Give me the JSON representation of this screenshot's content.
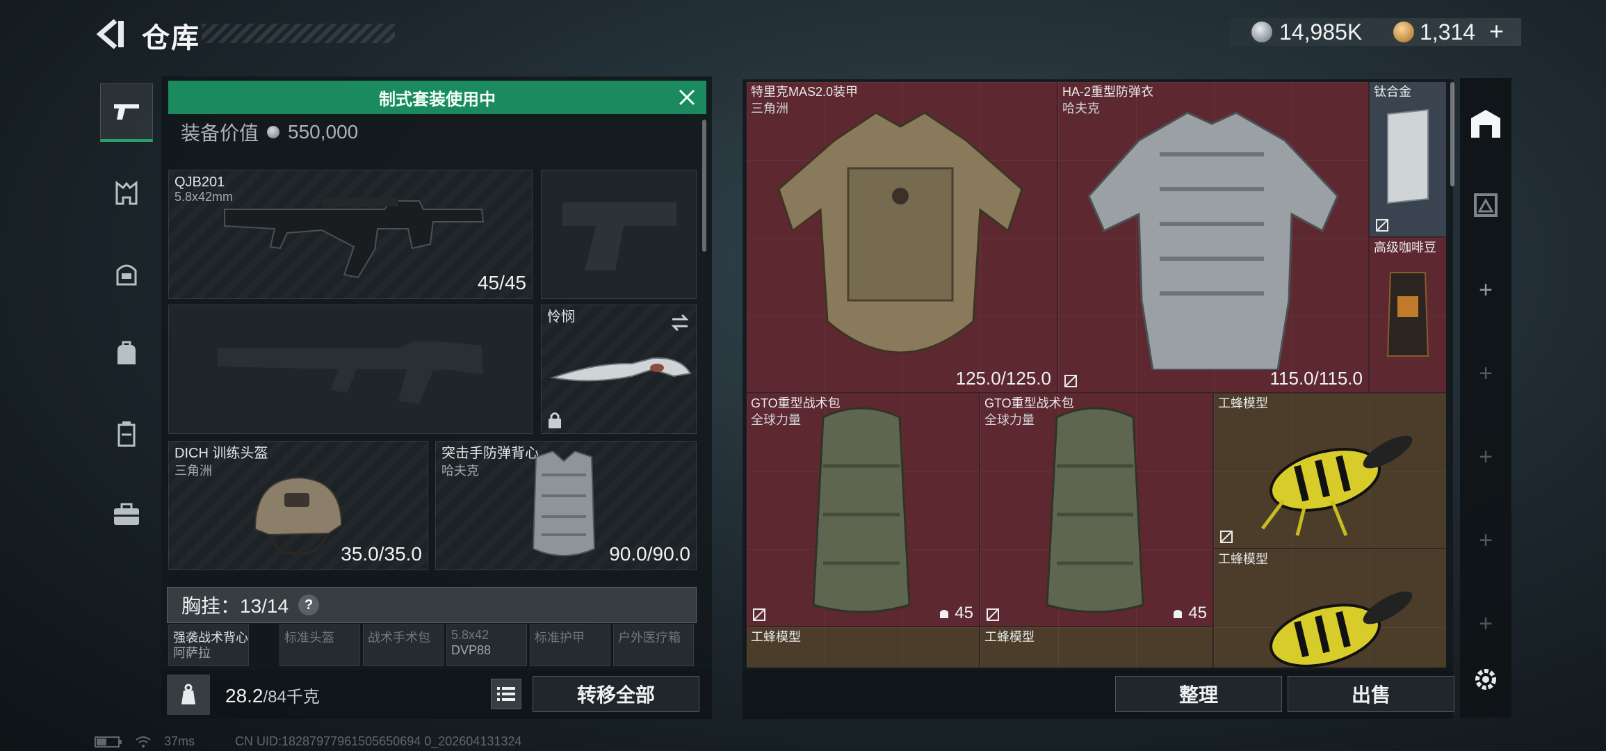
{
  "header": {
    "title": "仓库",
    "currency_1": "14,985K",
    "currency_2": "1,314",
    "currency_2_plus": "+"
  },
  "left_nav": {
    "tabs": [
      "gun-icon",
      "armor-set-icon",
      "helmet-icon",
      "backpack-icon",
      "rig-icon",
      "medkit-icon"
    ],
    "active": 0
  },
  "loadout": {
    "banner": "制式套装使用中",
    "value_label": "装备价值",
    "value": "550,000",
    "primary": {
      "name": "QJB201",
      "caliber": "5.8x42mm",
      "ammo": "45/45"
    },
    "knife": {
      "name": "怜悯"
    },
    "helmet": {
      "name": "DICH 训练头盔",
      "brand": "三角洲",
      "durability": "35.0/35.0"
    },
    "armor": {
      "name": "突击手防弹背心",
      "brand": "哈夫克",
      "durability": "90.0/90.0"
    },
    "chest_rig_label": "胸挂：13/14",
    "help": "?",
    "rig_slots": [
      {
        "name": "强袭战术背心",
        "sub": "阿萨拉",
        "filled": true
      },
      {
        "name": "标准头盔",
        "sub": "",
        "filled": false
      },
      {
        "name": "战术手术包",
        "sub": "",
        "filled": false
      },
      {
        "name": "5.8x42",
        "sub": "DVP88",
        "filled": false
      },
      {
        "name": "标准护甲",
        "sub": "",
        "filled": false
      },
      {
        "name": "户外医疗箱",
        "sub": "",
        "filled": false
      }
    ],
    "weight": "28.2",
    "weight_cap": "/84千克",
    "transfer_all": "转移全部"
  },
  "storage": {
    "items": [
      {
        "name": "特里克MAS2.0装甲",
        "brand": "三角洲",
        "durability": "125.0/125.0"
      },
      {
        "name": "HA-2重型防弹衣",
        "brand": "哈夫克",
        "durability": "115.0/115.0"
      },
      {
        "name": "钛合金"
      },
      {
        "name": "高级咖啡豆"
      },
      {
        "name": "GTO重型战术包",
        "brand": "全球力量",
        "count": "45"
      },
      {
        "name": "GTO重型战术包",
        "brand": "全球力量",
        "count": "45"
      },
      {
        "name": "工蜂模型"
      },
      {
        "name": "工蜂模型"
      },
      {
        "name": "工蜂模型"
      },
      {
        "name": "工蜂模型"
      }
    ],
    "sort": "整理",
    "sell": "出售"
  },
  "status": {
    "ping": "37ms",
    "uid": "CN UID:18287977961505650694 0_202604131324"
  },
  "colors": {
    "banner": "#1b8a5e",
    "red_rarity": "#5e2830",
    "gold_rarity": "#4c3c2a",
    "blue_rarity": "#3a4350"
  }
}
